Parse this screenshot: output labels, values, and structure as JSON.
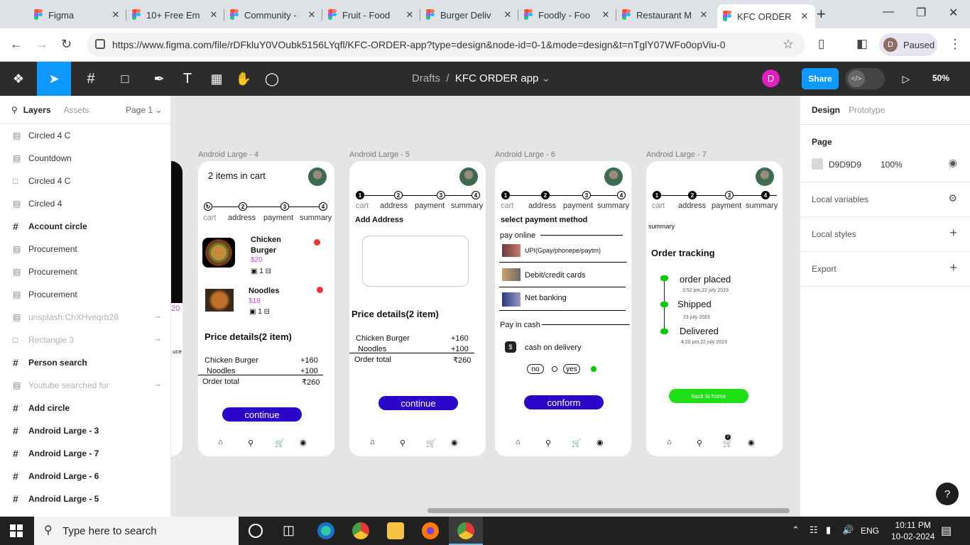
{
  "browser": {
    "tabs": [
      {
        "title": "Figma"
      },
      {
        "title": "10+ Free Em"
      },
      {
        "title": "Community -"
      },
      {
        "title": "Fruit - Food"
      },
      {
        "title": "Burger Deliv"
      },
      {
        "title": "Foodly - Foo"
      },
      {
        "title": "Restaurant M"
      },
      {
        "title": "KFC ORDER"
      }
    ],
    "url": "https://www.figma.com/file/rDFkluY0VOubk5156LYqfl/KFC-ORDER-app?type=design&node-id=0-1&mode=design&t=nTglY07WFo0opViu-0",
    "profile": {
      "initial": "D",
      "status": "Paused"
    }
  },
  "figma": {
    "breadcrumb": {
      "drafts": "Drafts",
      "file": "KFC ORDER app"
    },
    "user_initial": "D",
    "share": "Share",
    "zoom": "50%"
  },
  "left_panel": {
    "tab_layers": "Layers",
    "tab_assets": "Assets",
    "page": "Page 1",
    "layers": [
      {
        "name": "Circled 4 C",
        "type": "img"
      },
      {
        "name": "Countdown",
        "type": "img"
      },
      {
        "name": "Circled 4 C",
        "type": "rect"
      },
      {
        "name": "Circled 4",
        "type": "img"
      },
      {
        "name": "Account circle",
        "type": "frame"
      },
      {
        "name": "Procurement",
        "type": "img"
      },
      {
        "name": "Procurement",
        "type": "img"
      },
      {
        "name": "Procurement",
        "type": "img"
      },
      {
        "name": "unsplash:ChXHveqrb28",
        "type": "img",
        "hidden": true
      },
      {
        "name": "Rectangle 3",
        "type": "rect",
        "hidden": true
      },
      {
        "name": "Person search",
        "type": "frame"
      },
      {
        "name": "Youtube searched for",
        "type": "img",
        "hidden": true
      },
      {
        "name": "Add circle",
        "type": "frame"
      },
      {
        "name": "Android Large - 3",
        "type": "frame"
      },
      {
        "name": "Android Large - 7",
        "type": "frame"
      },
      {
        "name": "Android Large - 6",
        "type": "frame"
      },
      {
        "name": "Android Large - 5",
        "type": "frame"
      }
    ]
  },
  "right_panel": {
    "tab_design": "Design",
    "tab_prototype": "Prototype",
    "page_title": "Page",
    "page_color": "D9D9D9",
    "page_opacity": "100%",
    "local_variables": "Local variables",
    "local_styles": "Local styles",
    "export": "Export"
  },
  "canvas": {
    "frames": [
      {
        "label": "Android Large - 4",
        "title": "2 items in cart",
        "steps": [
          "cart",
          "address",
          "payment",
          "summary"
        ],
        "items": [
          {
            "name": "Chicken Burger",
            "price": "$20",
            "qty": "1"
          },
          {
            "name": "Noodles",
            "price": "$18",
            "qty": "1"
          }
        ],
        "price_title": "Price details(2 item)",
        "rows": [
          {
            "k": "Chicken Burger",
            "v": "+160"
          },
          {
            "k": "Noodles",
            "v": "+100"
          }
        ],
        "total_k": "Order total",
        "total_v": "₹260",
        "button": "continue",
        "partial_price": "20",
        "partial_text": "uce"
      },
      {
        "label": "Android Large - 5",
        "steps": [
          "cart",
          "address",
          "payment",
          "summary"
        ],
        "heading": "Add Address",
        "price_title": "Price details(2 item)",
        "rows": [
          {
            "k": "Chicken Burger",
            "v": "+160"
          },
          {
            "k": "Noodles",
            "v": "+100"
          }
        ],
        "total_k": "Order total",
        "total_v": "₹260",
        "button": "continue"
      },
      {
        "label": "Android Large - 6",
        "steps": [
          "cart",
          "address",
          "payment",
          "summary"
        ],
        "heading": "select payment method",
        "pay_online": "pay online",
        "methods": [
          "UPI(Gpay/phonepe/paytm)",
          "Debit/credit cards",
          "Net banking"
        ],
        "pay_cash": "Pay in cash",
        "cod": "cash on delivery",
        "no": "no",
        "yes": "yes",
        "button": "conform"
      },
      {
        "label": "Android Large - 7",
        "steps": [
          "cart",
          "address",
          "payment",
          "summary"
        ],
        "summary": "summary",
        "heading": "Order tracking",
        "track": [
          {
            "t": "order placed",
            "d": "3:52 pm,22 july 2023"
          },
          {
            "t": "Shipped",
            "d": "23 july 2023"
          },
          {
            "t": "Delivered",
            "d": "4.20 pm,22 july 2023"
          }
        ],
        "button": "back to home",
        "cart_badge": "2"
      }
    ]
  },
  "taskbar": {
    "search": "Type here to search",
    "lang": "ENG",
    "time": "10:11 PM",
    "date": "10-02-2024"
  }
}
